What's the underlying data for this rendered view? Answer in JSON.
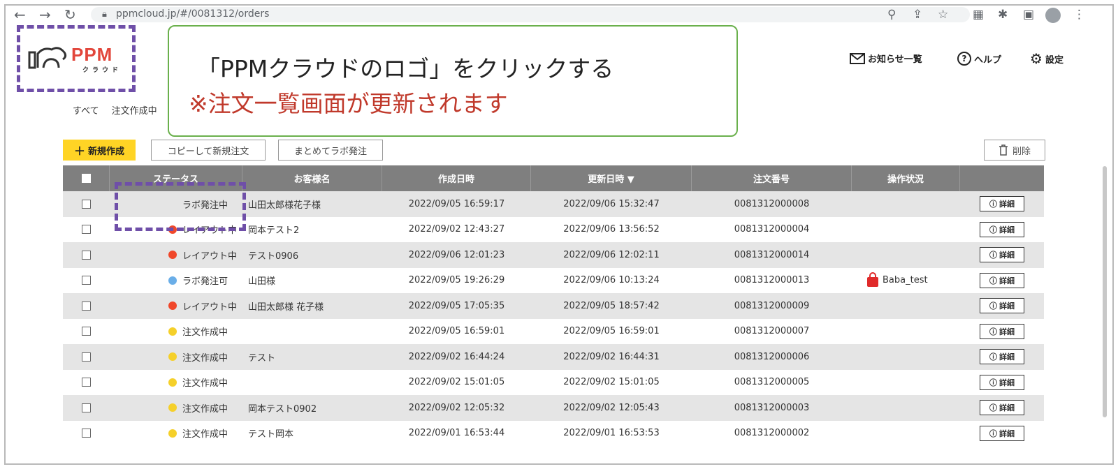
{
  "browser": {
    "url": "ppmcloud.jp/#/0081312/orders"
  },
  "logo": {
    "name": "PPM",
    "kana": "クラウド"
  },
  "header": {
    "notices_label": "お知らせ一覧",
    "help_label": "ヘルプ",
    "settings_label": "設定"
  },
  "callout": {
    "line1": "「PPMクラウドのロゴ」をクリックする",
    "line2": "※注文一覧画面が更新されます"
  },
  "tabs": [
    "すべて",
    "注文作成中"
  ],
  "toolbar": {
    "new_label": "新規作成",
    "copy_label": "コピーして新規注文",
    "batch_label": "まとめてラボ発注",
    "delete_label": "削除"
  },
  "table": {
    "columns": [
      "ステータス",
      "お客様名",
      "作成日時",
      "更新日時 ▼",
      "注文番号",
      "操作状況"
    ],
    "detail_label": "詳細",
    "rows": [
      {
        "status": "ラボ発注中",
        "status_color": "",
        "customer": "山田太郎様花子様",
        "created": "2022/09/05 16:59:17",
        "updated": "2022/09/06 15:32:47",
        "order_no": "0081312000008",
        "op": ""
      },
      {
        "status": "レイアウト中",
        "status_color": "#f0472a",
        "customer": "岡本テスト2",
        "created": "2022/09/02 12:43:27",
        "updated": "2022/09/06 13:56:52",
        "order_no": "0081312000004",
        "op": ""
      },
      {
        "status": "レイアウト中",
        "status_color": "#f0472a",
        "customer": "テスト0906",
        "created": "2022/09/06 12:01:23",
        "updated": "2022/09/06 12:02:11",
        "order_no": "0081312000014",
        "op": ""
      },
      {
        "status": "ラボ発注可",
        "status_color": "#6aaee8",
        "customer": "山田様",
        "created": "2022/09/05 19:26:29",
        "updated": "2022/09/06 10:13:24",
        "order_no": "0081312000013",
        "op": "Baba_test"
      },
      {
        "status": "レイアウト中",
        "status_color": "#f0472a",
        "customer": "山田太郎様 花子様",
        "created": "2022/09/05 17:05:35",
        "updated": "2022/09/05 18:57:42",
        "order_no": "0081312000009",
        "op": ""
      },
      {
        "status": "注文作成中",
        "status_color": "#f5d02a",
        "customer": "",
        "created": "2022/09/05 16:59:01",
        "updated": "2022/09/05 16:59:01",
        "order_no": "0081312000007",
        "op": ""
      },
      {
        "status": "注文作成中",
        "status_color": "#f5d02a",
        "customer": "テスト",
        "created": "2022/09/02 16:44:24",
        "updated": "2022/09/02 16:44:31",
        "order_no": "0081312000006",
        "op": ""
      },
      {
        "status": "注文作成中",
        "status_color": "#f5d02a",
        "customer": "",
        "created": "2022/09/02 15:01:05",
        "updated": "2022/09/02 15:01:05",
        "order_no": "0081312000005",
        "op": ""
      },
      {
        "status": "注文作成中",
        "status_color": "#f5d02a",
        "customer": "岡本テスト0902",
        "created": "2022/09/02 12:05:32",
        "updated": "2022/09/02 12:05:43",
        "order_no": "0081312000003",
        "op": ""
      },
      {
        "status": "注文作成中",
        "status_color": "#f5d02a",
        "customer": "テスト岡本",
        "created": "2022/09/01 16:53:44",
        "updated": "2022/09/01 16:53:53",
        "order_no": "0081312000002",
        "op": ""
      }
    ]
  },
  "colors": {
    "accent_yellow": "#ffd425",
    "highlight_purple": "#6f4fa8",
    "callout_green": "#6ab04c",
    "callout_red": "#c0392b"
  }
}
